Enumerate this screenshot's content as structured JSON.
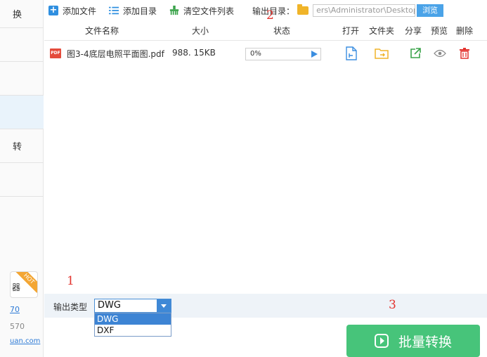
{
  "sidebar": {
    "items": [
      {
        "label": "换"
      },
      {
        "label": ""
      },
      {
        "label": ""
      },
      {
        "label": ""
      },
      {
        "label": "转"
      },
      {
        "label": ""
      }
    ],
    "badge_hot": "HOT",
    "badge_text": "器",
    "link1": "70",
    "number_text": "570",
    "link2": "uan.com"
  },
  "toolbar": {
    "add_file": "添加文件",
    "add_folder": "添加目录",
    "clear_list": "清空文件列表",
    "output_label": "输出目录：",
    "output_path": "ers\\Administrator\\Desktop",
    "browse": "浏览"
  },
  "table": {
    "headers": {
      "name": "文件名称",
      "size": "大小",
      "status": "状态",
      "open": "打开",
      "folder": "文件夹",
      "share": "分享",
      "preview": "预览",
      "delete": "删除"
    },
    "rows": [
      {
        "type_badge": "PDF",
        "name": "图3-4底层电照平面图.pdf",
        "size": "988. 15KB",
        "progress_text": "0%",
        "progress": 0
      }
    ]
  },
  "annotations": {
    "n1": "1",
    "n2": "2",
    "n3": "3"
  },
  "bottom": {
    "output_type_label": "输出类型",
    "selected": "DWG",
    "options": [
      "DWG",
      "DXF"
    ],
    "convert_label": "批量转换"
  },
  "colors": {
    "accent": "#3e88d6",
    "convert_green": "#47c47a",
    "annotation_red": "#e3342f"
  }
}
